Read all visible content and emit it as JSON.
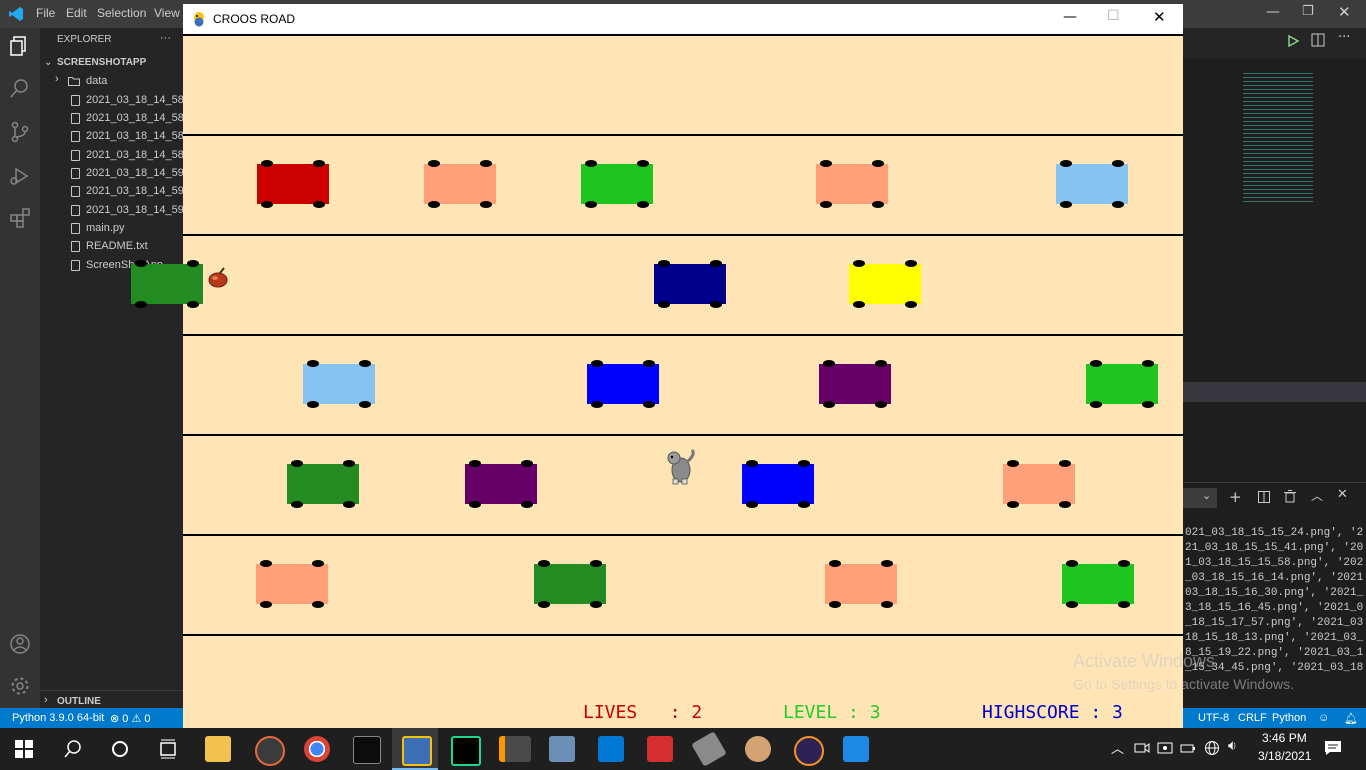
{
  "vscode": {
    "menu": [
      "File",
      "Edit",
      "Selection",
      "View"
    ],
    "explorer_title": "EXPLORER",
    "explorer_more": "···",
    "project_name": "SCREENSHOTAPP",
    "tree": [
      {
        "type": "folder",
        "label": "data"
      },
      {
        "type": "file",
        "label": "2021_03_18_14_58_..."
      },
      {
        "type": "file",
        "label": "2021_03_18_14_58_..."
      },
      {
        "type": "file",
        "label": "2021_03_18_14_58_..."
      },
      {
        "type": "file",
        "label": "2021_03_18_14_58_..."
      },
      {
        "type": "file",
        "label": "2021_03_18_14_59_..."
      },
      {
        "type": "file",
        "label": "2021_03_18_14_59_..."
      },
      {
        "type": "file",
        "label": "2021_03_18_14_59_..."
      },
      {
        "type": "file",
        "label": "main.py"
      },
      {
        "type": "file",
        "label": "README.txt"
      },
      {
        "type": "file",
        "label": "ScreenShotApp"
      }
    ],
    "outline_label": "OUTLINE",
    "status_left": "Python 3.9.0 64-bit",
    "status_problems": "⊗ 0 ⚠ 0",
    "status_right": [
      "UTF-8",
      "CRLF",
      "Python"
    ],
    "terminal_lines": [
      "021_03_18_15_15_24.png', '2",
      "21_03_18_15_15_41.png', '20",
      "1_03_18_15_15_58.png', '202",
      "_03_18_15_16_14.png', '2021",
      "03_18_15_16_30.png', '2021_",
      "3_18_15_16_45.png', '2021_0",
      "_18_15_17_57.png', '2021_03",
      "18_15_18_13.png', '2021_03_",
      "8_15_19_22.png', '2021_03_1",
      "_15_34_45.png', '2021_03_18"
    ]
  },
  "game": {
    "title": "CROOS ROAD",
    "lives_label": "LIVES   : 2",
    "level_label": "LEVEL : 3",
    "highscore_label": "HIGHSCORE : 3",
    "hud_colors": {
      "lives": "#cc0000",
      "level": "#22cc22",
      "highscore": "#0000cc"
    },
    "background_color": "#ffe4b5",
    "cars": [
      {
        "lane": 1,
        "color": "#cc0000"
      },
      {
        "lane": 1,
        "color": "#ffa07a"
      },
      {
        "lane": 1,
        "color": "#1ec51e"
      },
      {
        "lane": 1,
        "color": "#ffa07a"
      },
      {
        "lane": 1,
        "color": "#87c3f0"
      },
      {
        "lane": 2,
        "color": "#228b22"
      },
      {
        "lane": 2,
        "color": "#00008b"
      },
      {
        "lane": 2,
        "color": "#ffff00"
      },
      {
        "lane": 3,
        "color": "#87c3f0"
      },
      {
        "lane": 3,
        "color": "#0000ff"
      },
      {
        "lane": 3,
        "color": "#660066"
      },
      {
        "lane": 3,
        "color": "#1ec51e"
      },
      {
        "lane": 4,
        "color": "#228b22"
      },
      {
        "lane": 4,
        "color": "#660066"
      },
      {
        "lane": 4,
        "color": "#0000ff"
      },
      {
        "lane": 4,
        "color": "#ffa07a"
      },
      {
        "lane": 5,
        "color": "#ffa07a"
      },
      {
        "lane": 5,
        "color": "#228b22"
      },
      {
        "lane": 5,
        "color": "#ffa07a"
      },
      {
        "lane": 5,
        "color": "#1ec51e"
      }
    ]
  },
  "windows": {
    "activation_title": "Activate Windows",
    "activation_sub": "Go to Settings to activate Windows.",
    "clock_time": "3:46 PM",
    "clock_date": "3/18/2021"
  }
}
